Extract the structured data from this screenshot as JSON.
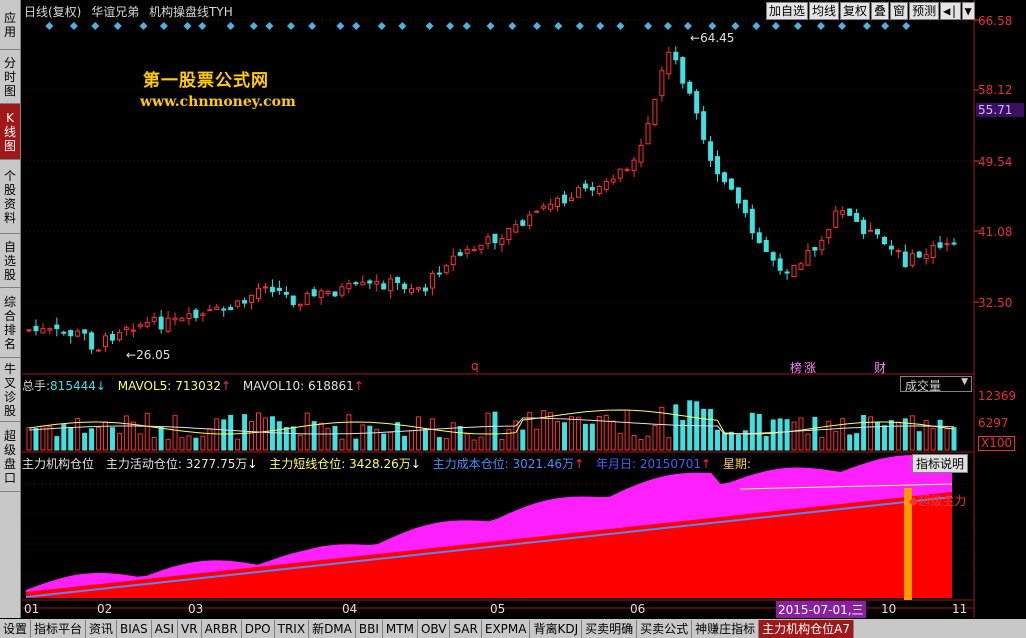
{
  "sidebar": {
    "tabs": [
      {
        "label": "应用",
        "active": false
      },
      {
        "label": "分时图",
        "active": false
      },
      {
        "label": "K线图",
        "active": true
      },
      {
        "label": "个股资料",
        "active": false
      },
      {
        "label": "自选股",
        "active": false
      },
      {
        "label": "综合排名",
        "active": false
      },
      {
        "label": "牛叉诊股",
        "active": false
      },
      {
        "label": "超级盘口",
        "active": false
      }
    ]
  },
  "header": {
    "period": "日线(复权)",
    "stock_name": "华谊兄弟",
    "indicator": "机构操盘线TYH",
    "toolbar": [
      "加自选",
      "均线",
      "复权",
      "叠",
      "窗",
      "预测"
    ],
    "toolbar_icons": [
      "◀|",
      "▼"
    ]
  },
  "watermark": {
    "line1": "第一股票公式网",
    "line2": "www.chnmoney.com"
  },
  "price_axis": {
    "labels": [
      "66.58",
      "58.12",
      "49.54",
      "41.08",
      "32.50"
    ],
    "current_price": "55.71",
    "high_label": "64.45",
    "low_label": "26.05"
  },
  "event_markers": [
    "q",
    "榜",
    "涨",
    "财"
  ],
  "volume_panel": {
    "total": {
      "label": "总手:",
      "value": "815444",
      "dir": "down"
    },
    "mavol5": {
      "label": "MAVOL5:",
      "value": "713032",
      "dir": "up"
    },
    "mavol10": {
      "label": "MAVOL10:",
      "value": "618861",
      "dir": "up"
    },
    "dropdown": "成交量",
    "axis_labels": [
      "12369",
      "6297"
    ],
    "unit": "X100"
  },
  "indicator_panel": {
    "name": "主力机构仓位",
    "items": [
      {
        "label": "主力活动仓位:",
        "value": "3277.75万",
        "dir": "down"
      },
      {
        "label": "主力短线仓位:",
        "value": "3428.26万",
        "dir": "down"
      },
      {
        "label": "主力成本仓位:",
        "value": "3021.46万",
        "dir": "up"
      },
      {
        "label": "年月日:",
        "value": "20150701",
        "dir": "up"
      },
      {
        "label": "星期:",
        "value": "",
        "dir": ""
      }
    ],
    "help_button": "指标说明",
    "signal_label": "◆超级主力"
  },
  "x_axis": {
    "ticks": [
      "01",
      "02",
      "03",
      "04",
      "05",
      "06",
      "10",
      "11"
    ],
    "cursor_date": "2015-07-01,三"
  },
  "bottom_tabs": [
    {
      "label": "设置",
      "active": false
    },
    {
      "label": "指标平台",
      "active": false
    },
    {
      "label": "资讯",
      "active": false
    },
    {
      "label": "BIAS",
      "active": false
    },
    {
      "label": "ASI",
      "active": false
    },
    {
      "label": "VR",
      "active": false
    },
    {
      "label": "ARBR",
      "active": false
    },
    {
      "label": "DPO",
      "active": false
    },
    {
      "label": "TRIX",
      "active": false
    },
    {
      "label": "新DMA",
      "active": false
    },
    {
      "label": "BBI",
      "active": false
    },
    {
      "label": "MTM",
      "active": false
    },
    {
      "label": "OBV",
      "active": false
    },
    {
      "label": "SAR",
      "active": false
    },
    {
      "label": "EXPMA",
      "active": false
    },
    {
      "label": "背离KDJ",
      "active": false
    },
    {
      "label": "买卖明确",
      "active": false
    },
    {
      "label": "买卖公式",
      "active": false
    },
    {
      "label": "神赚庄指标",
      "active": false
    },
    {
      "label": "主力机构仓位A7",
      "active": true
    }
  ],
  "colors": {
    "up": "#ff3030",
    "down": "#40e0e0",
    "pink": "#ff20ff",
    "red_fill": "#ff0000",
    "cursor": "#ff9900"
  }
}
